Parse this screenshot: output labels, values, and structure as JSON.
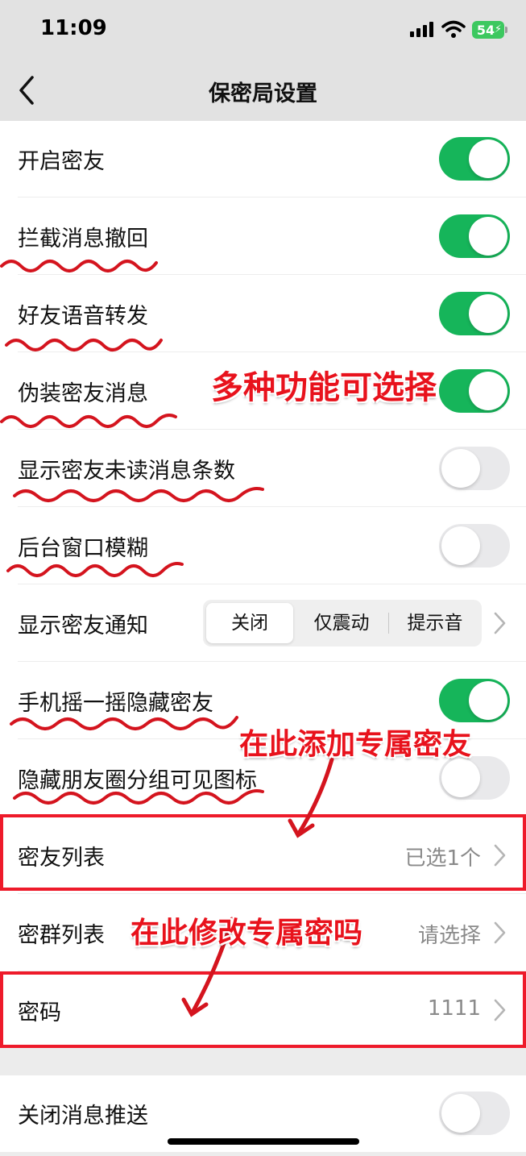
{
  "status_bar": {
    "time": "11:09",
    "battery": "54"
  },
  "nav": {
    "title": "保密局设置"
  },
  "rows": [
    {
      "label": "开启密友",
      "toggle_on": true
    },
    {
      "label": "拦截消息撤回",
      "toggle_on": true
    },
    {
      "label": "好友语音转发",
      "toggle_on": true
    },
    {
      "label": "伪装密友消息",
      "toggle_on": true
    },
    {
      "label": "显示密友未读消息条数",
      "toggle_on": false
    },
    {
      "label": "后台窗口模糊",
      "toggle_on": false
    },
    {
      "label": "显示密友通知",
      "options": [
        "关闭",
        "仅震动",
        "提示音"
      ],
      "selected": "关闭"
    },
    {
      "label": "手机摇一摇隐藏密友",
      "toggle_on": true
    },
    {
      "label": "隐藏朋友圈分组可见图标",
      "toggle_on": false
    },
    {
      "label": "密友列表",
      "value": "已选1个"
    },
    {
      "label": "密群列表",
      "value": "请选择"
    },
    {
      "label": "密码",
      "value": "1111"
    }
  ],
  "last_row": {
    "label": "关闭消息推送",
    "toggle_on": false
  },
  "annotations": {
    "functions": "多种功能可选择",
    "add_friend": "在此添加专属密友",
    "change_password": "在此修改专属密吗"
  },
  "colors": {
    "toggle_on": "#16b55a",
    "annotation_red": "#e8121c"
  }
}
